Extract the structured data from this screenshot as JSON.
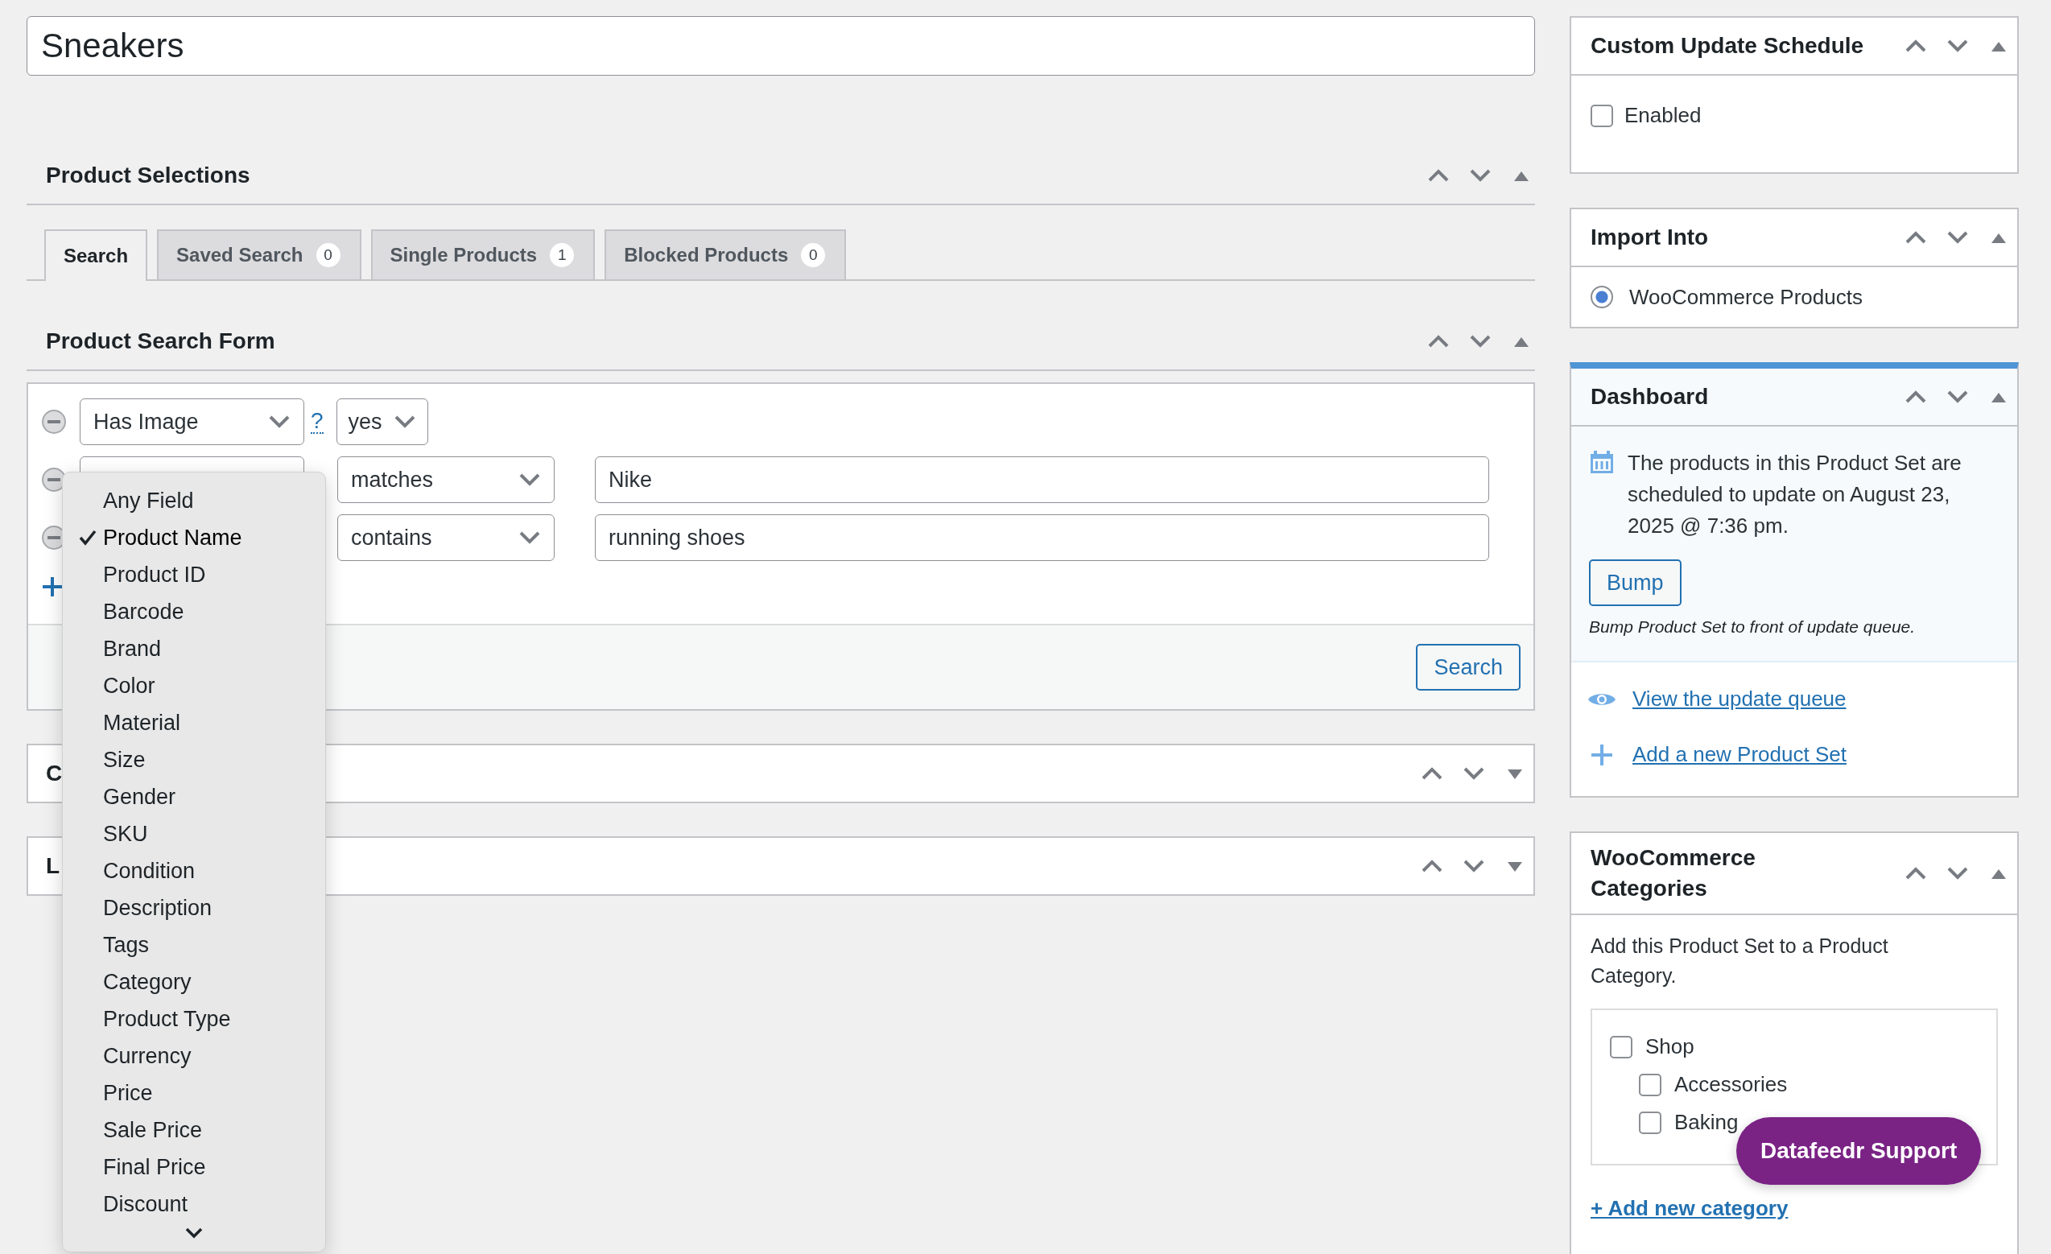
{
  "title_field": {
    "value": "Sneakers"
  },
  "product_selections": {
    "title": "Product Selections",
    "expanded": true,
    "tabs": [
      {
        "label": "Search",
        "selected": true
      },
      {
        "label": "Saved Search",
        "count": "0",
        "selected": false
      },
      {
        "label": "Single Products",
        "count": "1",
        "selected": false
      },
      {
        "label": "Blocked Products",
        "count": "0",
        "selected": false
      }
    ]
  },
  "search_form": {
    "title": "Product Search Form",
    "expanded": true,
    "rows": [
      {
        "field": "Has Image",
        "help": "?",
        "operator": "yes"
      },
      {
        "field_box": true,
        "operator": "matches",
        "value": "Nike"
      },
      {
        "operator": "contains",
        "value": "running shoes"
      }
    ],
    "button": "Search"
  },
  "field_menu": {
    "items": [
      {
        "label": "Any Field",
        "selected": false
      },
      {
        "label": "Product Name",
        "selected": true
      },
      {
        "label": "Product ID",
        "selected": false
      },
      {
        "label": "Barcode",
        "selected": false
      },
      {
        "label": "Brand",
        "selected": false
      },
      {
        "label": "Color",
        "selected": false
      },
      {
        "label": "Material",
        "selected": false
      },
      {
        "label": "Size",
        "selected": false
      },
      {
        "label": "Gender",
        "selected": false
      },
      {
        "label": "SKU",
        "selected": false
      },
      {
        "label": "Condition",
        "selected": false
      },
      {
        "label": "Description",
        "selected": false
      },
      {
        "label": "Tags",
        "selected": false
      },
      {
        "label": "Category",
        "selected": false
      },
      {
        "label": "Product Type",
        "selected": false
      },
      {
        "label": "Currency",
        "selected": false
      },
      {
        "label": "Price",
        "selected": false
      },
      {
        "label": "Sale Price",
        "selected": false
      },
      {
        "label": "Final Price",
        "selected": false
      },
      {
        "label": "Discount",
        "selected": false
      }
    ]
  },
  "collapsed_boxes": [
    {
      "title": "C",
      "expanded": false
    },
    {
      "title": "L",
      "expanded": false
    }
  ],
  "custom_update_schedule": {
    "title": "Custom Update Schedule",
    "expanded": true,
    "option": {
      "label": "Enabled",
      "checked": false
    }
  },
  "import_into": {
    "title": "Import Into",
    "expanded": true,
    "option": {
      "label": "WooCommerce Products",
      "selected": true
    }
  },
  "dashboard": {
    "title": "Dashboard",
    "expanded": true,
    "message": "The products in this Product Set are scheduled to update on August 23, 2025 @ 7:36 pm.",
    "button": "Bump",
    "hint": "Bump Product Set to front of update queue.",
    "links": [
      {
        "kind": "view",
        "label": "View the update queue"
      },
      {
        "kind": "add",
        "label": "Add a new Product Set"
      }
    ]
  },
  "categories": {
    "title": "WooCommerce Categories",
    "expanded": true,
    "description": "Add this Product Set to a Product Category.",
    "items": [
      {
        "label": "Shop",
        "checked": false,
        "children": [
          {
            "label": "Accessories",
            "checked": false
          },
          {
            "label": "Baking",
            "checked": false
          }
        ]
      }
    ],
    "add_link": "+ Add new category"
  },
  "support_button": "Datafeedr Support"
}
